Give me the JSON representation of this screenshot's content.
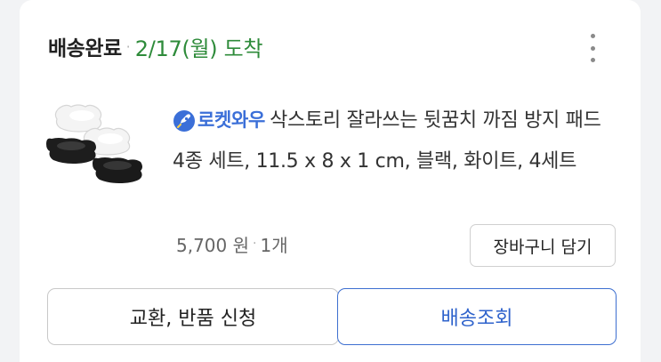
{
  "order": {
    "status_label": "배송완료",
    "separator": "·",
    "arrival": "2/17(월) 도착"
  },
  "product": {
    "badge_label": "로켓와우",
    "title": "삭스토리 잘라쓰는 뒷꿈치 까짐 방지 패드 4종 세트, 11.5 x 8 x 1 cm, 블랙, 화이트, 4세트",
    "price": "5,700 원",
    "quantity": "1개",
    "cart_button_label": "장바구니 담기"
  },
  "actions": {
    "exchange_label": "교환, 반품 신청",
    "tracking_label": "배송조회"
  },
  "colors": {
    "arrival": "#2e8b3a",
    "rocket_accent": "#3b6fd8",
    "tracking_border": "#3d6fd0"
  },
  "icons": {
    "more": "more-vertical-icon",
    "rocket": "rocket-icon"
  }
}
